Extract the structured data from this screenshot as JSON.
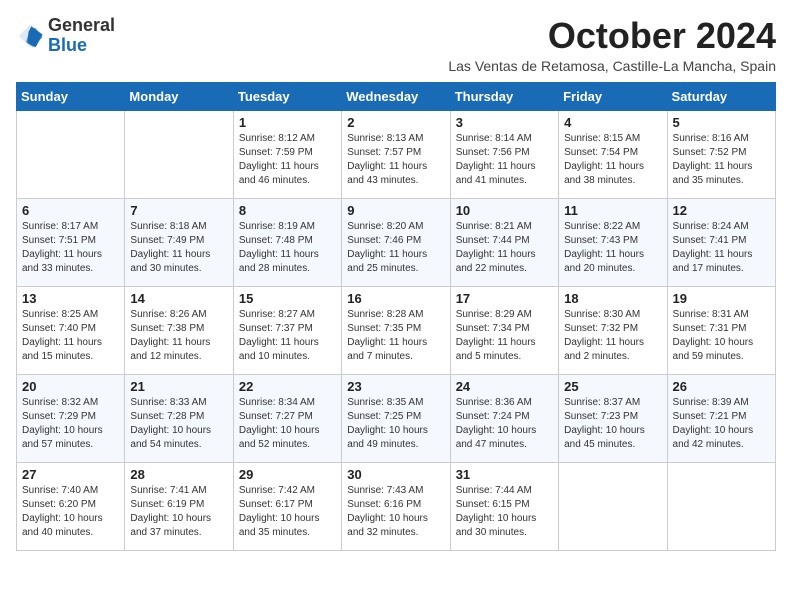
{
  "header": {
    "logo_general": "General",
    "logo_blue": "Blue",
    "month_title": "October 2024",
    "subtitle": "Las Ventas de Retamosa, Castille-La Mancha, Spain"
  },
  "weekdays": [
    "Sunday",
    "Monday",
    "Tuesday",
    "Wednesday",
    "Thursday",
    "Friday",
    "Saturday"
  ],
  "weeks": [
    [
      {
        "day": "",
        "info": ""
      },
      {
        "day": "",
        "info": ""
      },
      {
        "day": "1",
        "info": "Sunrise: 8:12 AM\nSunset: 7:59 PM\nDaylight: 11 hours and 46 minutes."
      },
      {
        "day": "2",
        "info": "Sunrise: 8:13 AM\nSunset: 7:57 PM\nDaylight: 11 hours and 43 minutes."
      },
      {
        "day": "3",
        "info": "Sunrise: 8:14 AM\nSunset: 7:56 PM\nDaylight: 11 hours and 41 minutes."
      },
      {
        "day": "4",
        "info": "Sunrise: 8:15 AM\nSunset: 7:54 PM\nDaylight: 11 hours and 38 minutes."
      },
      {
        "day": "5",
        "info": "Sunrise: 8:16 AM\nSunset: 7:52 PM\nDaylight: 11 hours and 35 minutes."
      }
    ],
    [
      {
        "day": "6",
        "info": "Sunrise: 8:17 AM\nSunset: 7:51 PM\nDaylight: 11 hours and 33 minutes."
      },
      {
        "day": "7",
        "info": "Sunrise: 8:18 AM\nSunset: 7:49 PM\nDaylight: 11 hours and 30 minutes."
      },
      {
        "day": "8",
        "info": "Sunrise: 8:19 AM\nSunset: 7:48 PM\nDaylight: 11 hours and 28 minutes."
      },
      {
        "day": "9",
        "info": "Sunrise: 8:20 AM\nSunset: 7:46 PM\nDaylight: 11 hours and 25 minutes."
      },
      {
        "day": "10",
        "info": "Sunrise: 8:21 AM\nSunset: 7:44 PM\nDaylight: 11 hours and 22 minutes."
      },
      {
        "day": "11",
        "info": "Sunrise: 8:22 AM\nSunset: 7:43 PM\nDaylight: 11 hours and 20 minutes."
      },
      {
        "day": "12",
        "info": "Sunrise: 8:24 AM\nSunset: 7:41 PM\nDaylight: 11 hours and 17 minutes."
      }
    ],
    [
      {
        "day": "13",
        "info": "Sunrise: 8:25 AM\nSunset: 7:40 PM\nDaylight: 11 hours and 15 minutes."
      },
      {
        "day": "14",
        "info": "Sunrise: 8:26 AM\nSunset: 7:38 PM\nDaylight: 11 hours and 12 minutes."
      },
      {
        "day": "15",
        "info": "Sunrise: 8:27 AM\nSunset: 7:37 PM\nDaylight: 11 hours and 10 minutes."
      },
      {
        "day": "16",
        "info": "Sunrise: 8:28 AM\nSunset: 7:35 PM\nDaylight: 11 hours and 7 minutes."
      },
      {
        "day": "17",
        "info": "Sunrise: 8:29 AM\nSunset: 7:34 PM\nDaylight: 11 hours and 5 minutes."
      },
      {
        "day": "18",
        "info": "Sunrise: 8:30 AM\nSunset: 7:32 PM\nDaylight: 11 hours and 2 minutes."
      },
      {
        "day": "19",
        "info": "Sunrise: 8:31 AM\nSunset: 7:31 PM\nDaylight: 10 hours and 59 minutes."
      }
    ],
    [
      {
        "day": "20",
        "info": "Sunrise: 8:32 AM\nSunset: 7:29 PM\nDaylight: 10 hours and 57 minutes."
      },
      {
        "day": "21",
        "info": "Sunrise: 8:33 AM\nSunset: 7:28 PM\nDaylight: 10 hours and 54 minutes."
      },
      {
        "day": "22",
        "info": "Sunrise: 8:34 AM\nSunset: 7:27 PM\nDaylight: 10 hours and 52 minutes."
      },
      {
        "day": "23",
        "info": "Sunrise: 8:35 AM\nSunset: 7:25 PM\nDaylight: 10 hours and 49 minutes."
      },
      {
        "day": "24",
        "info": "Sunrise: 8:36 AM\nSunset: 7:24 PM\nDaylight: 10 hours and 47 minutes."
      },
      {
        "day": "25",
        "info": "Sunrise: 8:37 AM\nSunset: 7:23 PM\nDaylight: 10 hours and 45 minutes."
      },
      {
        "day": "26",
        "info": "Sunrise: 8:39 AM\nSunset: 7:21 PM\nDaylight: 10 hours and 42 minutes."
      }
    ],
    [
      {
        "day": "27",
        "info": "Sunrise: 7:40 AM\nSunset: 6:20 PM\nDaylight: 10 hours and 40 minutes."
      },
      {
        "day": "28",
        "info": "Sunrise: 7:41 AM\nSunset: 6:19 PM\nDaylight: 10 hours and 37 minutes."
      },
      {
        "day": "29",
        "info": "Sunrise: 7:42 AM\nSunset: 6:17 PM\nDaylight: 10 hours and 35 minutes."
      },
      {
        "day": "30",
        "info": "Sunrise: 7:43 AM\nSunset: 6:16 PM\nDaylight: 10 hours and 32 minutes."
      },
      {
        "day": "31",
        "info": "Sunrise: 7:44 AM\nSunset: 6:15 PM\nDaylight: 10 hours and 30 minutes."
      },
      {
        "day": "",
        "info": ""
      },
      {
        "day": "",
        "info": ""
      }
    ]
  ]
}
